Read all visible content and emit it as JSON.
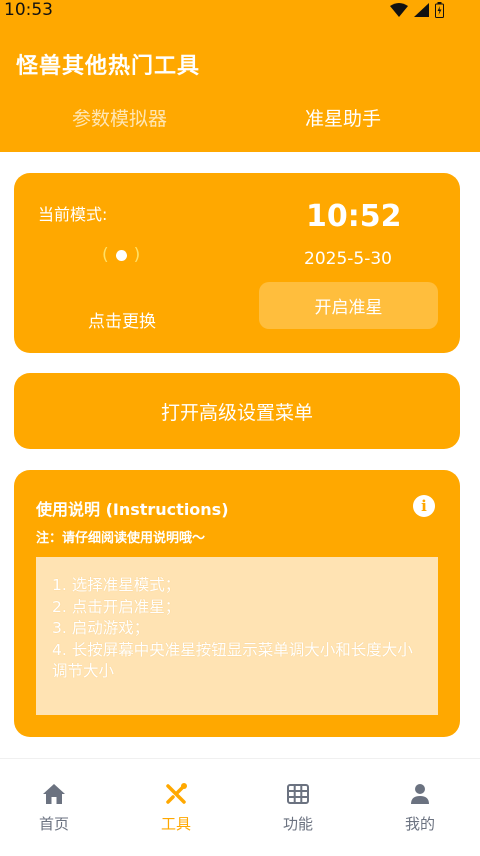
{
  "status_bar": {
    "time": "10:53"
  },
  "header": {
    "title": "怪兽其他热门工具",
    "tabs": [
      {
        "label": "参数模拟器",
        "active": false
      },
      {
        "label": "准星助手",
        "active": true
      }
    ]
  },
  "mode_card": {
    "mode_label": "当前模式:",
    "crosshair_left": "(",
    "crosshair_right": ")",
    "change_label": "点击更换",
    "time": "10:52",
    "date": "2025-5-30",
    "enable_button": "开启准星"
  },
  "menu_card": {
    "label": "打开高级设置菜单"
  },
  "instructions": {
    "title": "使用说明 (Instructions)",
    "note": "注：请仔细阅读使用说明哦～",
    "info_icon": "i",
    "steps": [
      "1. 选择准星模式；",
      "2. 点击开启准星；",
      "3. 启动游戏；",
      "4. 长按屏幕中央准星按钮显示菜单调大小和长度大小调节大小"
    ]
  },
  "bottom_nav": [
    {
      "label": "首页",
      "icon": "home-icon",
      "active": false
    },
    {
      "label": "工具",
      "icon": "tools-icon",
      "active": true
    },
    {
      "label": "功能",
      "icon": "grid-icon",
      "active": false
    },
    {
      "label": "我的",
      "icon": "user-icon",
      "active": false
    }
  ],
  "colors": {
    "accent": "#FFA800",
    "accent_light": "#FFBE3D",
    "instruction_box": "#FFE3B3",
    "inactive_nav": "#6b7280"
  }
}
